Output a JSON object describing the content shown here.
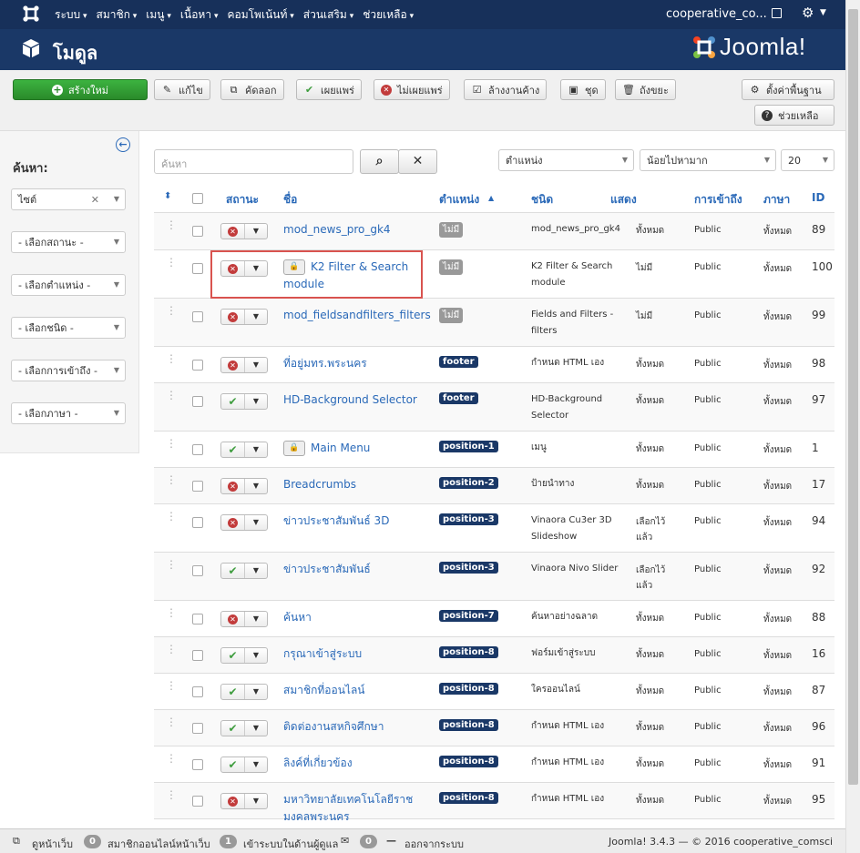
{
  "topnav": {
    "menu": [
      "ระบบ",
      "สมาชิก",
      "เมนู",
      "เนื้อหา",
      "คอมโพเน้นท์",
      "ส่วนเสริม",
      "ช่วยเหลือ"
    ],
    "site": "cooperative_co..."
  },
  "header": {
    "title": "โมดูล",
    "brand": "Joomla!"
  },
  "toolbar": {
    "new": "สร้างใหม่",
    "edit": "แก้ไข",
    "copy": "คัดลอก",
    "publish": "เผยแพร่",
    "unpublish": "ไม่เผยแพร่",
    "checkin": "ล้างงานค้าง",
    "batch": "ชุด",
    "trash": "ถังขยะ",
    "options": "ตั้งค่าพื้นฐาน",
    "help": "ช่วยเหลือ"
  },
  "sidebar": {
    "label": "ค้นหา:",
    "filters": [
      "ไซต์",
      "- เลือกสถานะ -",
      "- เลือกตำแหน่ง -",
      "- เลือกชนิด -",
      "- เลือกการเข้าถึง -",
      "- เลือกภาษา -"
    ]
  },
  "filterbar": {
    "search_placeholder": "ค้นหา",
    "position_select": "ตำแหน่ง",
    "order_select": "น้อยไปหามาก",
    "limit_select": "20"
  },
  "table": {
    "headers": {
      "status": "สถานะ",
      "title": "ชื่อ",
      "position": "ตำแหน่ง",
      "type": "ชนิด",
      "pages": "แสดง",
      "access": "การเข้าถึง",
      "language": "ภาษา",
      "id": "ID"
    },
    "rows": [
      {
        "title": "mod_news_pro_gk4",
        "position": "ไม่มี",
        "type": "mod_news_pro_gk4",
        "pages": "ทั้งหมด",
        "access": "Public",
        "language": "ทั้งหมด",
        "id": "89"
      },
      {
        "title": "K2 Filter & Search module",
        "position": "ไม่มี",
        "type": "K2 Filter & Search module",
        "pages": "ไม่มี",
        "access": "Public",
        "language": "ทั้งหมด",
        "id": "100"
      },
      {
        "title": "mod_fieldsandfilters_filters",
        "position": "ไม่มี",
        "type": "Fields and Filters - filters",
        "pages": "ไม่มี",
        "access": "Public",
        "language": "ทั้งหมด",
        "id": "99"
      },
      {
        "title": "ที่อยู่มทร.พระนคร",
        "position": "footer",
        "type": "กำหนด HTML เอง",
        "pages": "ทั้งหมด",
        "access": "Public",
        "language": "ทั้งหมด",
        "id": "98"
      },
      {
        "title": "HD-Background Selector",
        "position": "footer",
        "type": "HD-Background Selector",
        "pages": "ทั้งหมด",
        "access": "Public",
        "language": "ทั้งหมด",
        "id": "97"
      },
      {
        "title": "Main Menu",
        "position": "position-1",
        "type": "เมนู",
        "pages": "ทั้งหมด",
        "access": "Public",
        "language": "ทั้งหมด",
        "id": "1"
      },
      {
        "title": "Breadcrumbs",
        "position": "position-2",
        "type": "ป้ายนำทาง",
        "pages": "ทั้งหมด",
        "access": "Public",
        "language": "ทั้งหมด",
        "id": "17"
      },
      {
        "title": "ข่าวประชาสัมพันธ์ 3D",
        "position": "position-3",
        "type": "Vinaora Cu3er 3D Slideshow",
        "pages": "เลือกไว้แล้ว",
        "access": "Public",
        "language": "ทั้งหมด",
        "id": "94"
      },
      {
        "title": "ข่าวประชาสัมพันธ์",
        "position": "position-3",
        "type": "Vinaora Nivo Slider",
        "pages": "เลือกไว้แล้ว",
        "access": "Public",
        "language": "ทั้งหมด",
        "id": "92"
      },
      {
        "title": "ค้นหา",
        "position": "position-7",
        "type": "ค้นหาอย่างฉลาด",
        "pages": "ทั้งหมด",
        "access": "Public",
        "language": "ทั้งหมด",
        "id": "88"
      },
      {
        "title": "กรุณาเข้าสู่ระบบ",
        "position": "position-8",
        "type": "ฟอร์มเข้าสู่ระบบ",
        "pages": "ทั้งหมด",
        "access": "Public",
        "language": "ทั้งหมด",
        "id": "16"
      },
      {
        "title": "สมาชิกที่ออนไลน์",
        "position": "position-8",
        "type": "ใครออนไลน์",
        "pages": "ทั้งหมด",
        "access": "Public",
        "language": "ทั้งหมด",
        "id": "87"
      },
      {
        "title": "ติดต่องานสหกิจศึกษา",
        "position": "position-8",
        "type": "กำหนด HTML เอง",
        "pages": "ทั้งหมด",
        "access": "Public",
        "language": "ทั้งหมด",
        "id": "96"
      },
      {
        "title": "ลิงค์ที่เกี่ยวข้อง",
        "position": "position-8",
        "type": "กำหนด HTML เอง",
        "pages": "ทั้งหมด",
        "access": "Public",
        "language": "ทั้งหมด",
        "id": "91"
      },
      {
        "title": "มหาวิทยาลัยเทคโนโลยีราชมงคลพระนคร",
        "position": "position-8",
        "type": "กำหนด HTML เอง",
        "pages": "ทั้งหมด",
        "access": "Public",
        "language": "ทั้งหมด",
        "id": "95"
      }
    ]
  },
  "footer": {
    "view_site": "ดูหน้าเว็บ",
    "visitors_count": "0",
    "visitors_label": "สมาชิกออนไลน์หน้าเว็บ",
    "admins_count": "1",
    "admins_label": "เข้าระบบในด้านผู้ดูแล",
    "messages_count": "0",
    "logout": "ออกจากระบบ",
    "version": "Joomla! 3.4.3 — © 2016 cooperative_comsci"
  }
}
